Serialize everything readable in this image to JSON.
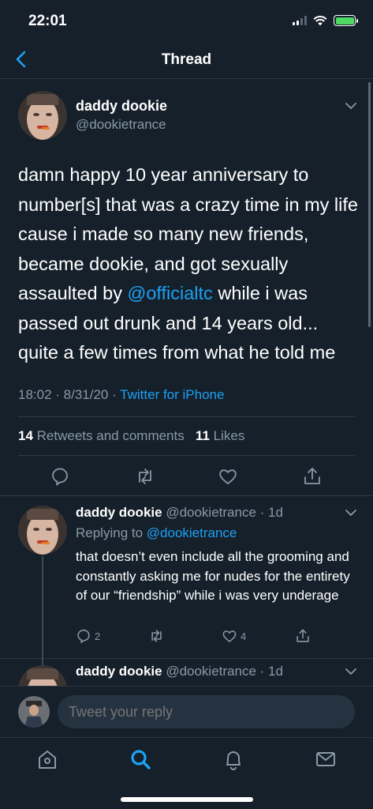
{
  "status": {
    "time": "22:01"
  },
  "nav": {
    "title": "Thread"
  },
  "tweet": {
    "name": "daddy dookie",
    "handle": "@dookietrance",
    "text_before": "damn happy 10 year anniversary to number[s] that was a crazy time in my life cause i made so many new friends, became dookie, and got sexually assaulted by ",
    "mention": "@officialtc",
    "text_after": " while i was passed out drunk and 14 years old... quite a few times from what he told me",
    "time_date": "18:02 · 8/31/20 · ",
    "source": "Twitter for iPhone",
    "retweets_count": "14",
    "retweets_label": "Retweets and comments",
    "likes_count": "11",
    "likes_label": "Likes"
  },
  "replies": [
    {
      "name": "daddy dookie",
      "handle_time": "@dookietrance · 1d",
      "replying_label": "Replying to ",
      "replying_to": "@dookietrance",
      "text": "that doesn’t even include all the grooming and constantly asking me for nudes for the entirety of our “friendship” while i was very underage",
      "reply_count": "2",
      "like_count": "4"
    },
    {
      "name": "daddy dookie",
      "handle_time": "@dookietrance · 1d"
    }
  ],
  "compose": {
    "placeholder": "Tweet your reply"
  },
  "icons": {
    "back": "chevron-left-icon",
    "reply": "comment-icon",
    "retweet": "retweet-icon",
    "like": "heart-icon",
    "share": "share-icon",
    "home": "home-icon",
    "search": "search-icon",
    "notifications": "bell-icon",
    "messages": "mail-icon"
  },
  "colors": {
    "background": "#15202b",
    "accent": "#1da1f2",
    "muted": "#8899a6"
  }
}
